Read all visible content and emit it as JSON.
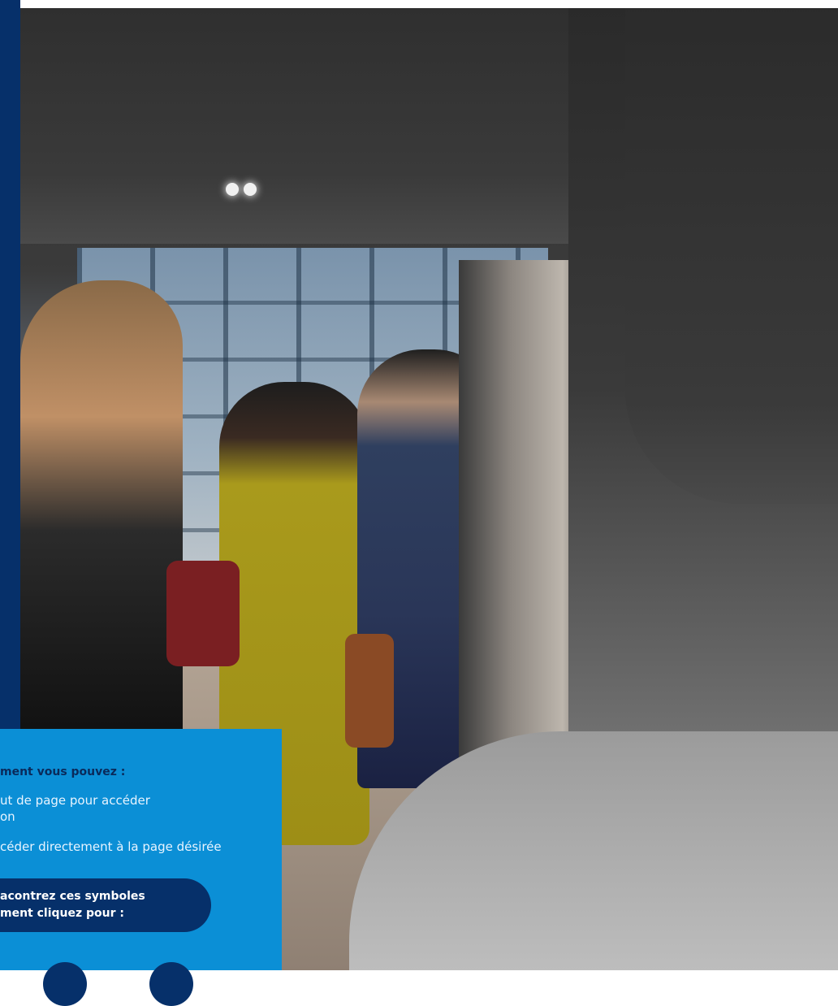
{
  "photo": {
    "description_icon": "car-interior-photo"
  },
  "info": {
    "heading": "ment vous pouvez :",
    "line1": "ut de page pour accéder",
    "line2": "on",
    "line3": "céder directement à la page désirée",
    "pill_line1": "acontrez ces symboles",
    "pill_line2": "ment cliquez pour :"
  },
  "colors": {
    "navy": "#06306a",
    "panel_blue": "#0b8fd6"
  }
}
